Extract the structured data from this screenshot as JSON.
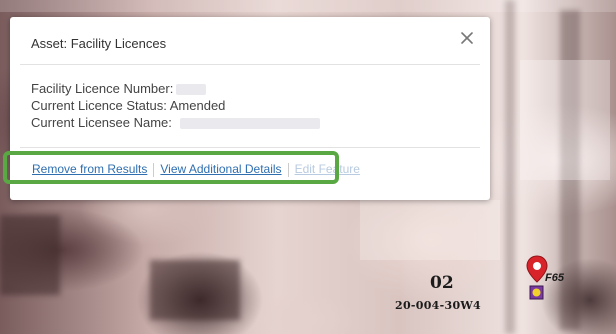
{
  "popup": {
    "title": "Asset: Facility Licences",
    "fields": [
      {
        "label": "Facility Licence Number:",
        "value": ""
      },
      {
        "label": "Current Licence Status:",
        "value": "Amended"
      },
      {
        "label": "Current Licensee Name:",
        "value": ""
      }
    ],
    "actions": {
      "remove": "Remove from Results",
      "view_details": "View Additional Details",
      "edit": "Edit Feature"
    }
  },
  "map": {
    "lsd_label": "02",
    "legal_label": "20-004-30W4",
    "pin_label": "F65",
    "pin_color": "#d8232a",
    "highlight_color": "#5aa844",
    "link_color": "#2f6fb0"
  }
}
